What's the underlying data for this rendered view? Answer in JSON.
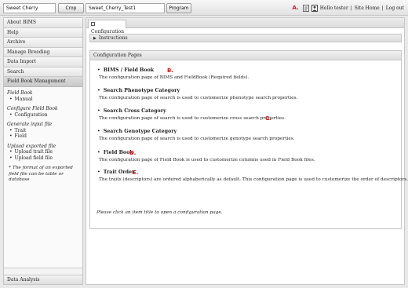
{
  "topbar": {
    "crop_value": "Sweet Cherry",
    "crop_button": "Crop",
    "program_value": "Sweet_Cherry_Test1",
    "program_button": "Program",
    "marker": "A.",
    "greeting": "Hello tester",
    "sep1": "|",
    "site_home": "Site Home",
    "sep2": "|",
    "logout": "Log out"
  },
  "sidebar": {
    "items": [
      {
        "label": "About BIMS"
      },
      {
        "label": "Help"
      },
      {
        "label": "Archive"
      },
      {
        "label": "Manage Breeding"
      },
      {
        "label": "Data Import"
      },
      {
        "label": "Search"
      },
      {
        "label": "Field Book Management"
      }
    ],
    "sub": {
      "field_book_head": "Field Book",
      "manual": "Manual",
      "configure_head": "Configure Field Book",
      "configuration": "Configuration",
      "generate_head": "Generate input file",
      "trait": "Trait",
      "field": "Field",
      "upload_head": "Upload exported file",
      "upload_trait": "Upload trait file",
      "upload_field": "Upload field file",
      "note": "* The format of an exported field file can be table or database"
    },
    "bottom": "Data Analysis"
  },
  "main": {
    "tab": "Configuration",
    "instructions": "Instructions",
    "panel_title": "Configuration Pages",
    "entries": [
      {
        "title": "BIMS / Field Book",
        "mark": "B.",
        "desc": "The configuration page of BIMS and FieldBook (Required fields)."
      },
      {
        "title": "Search Phenotype Category",
        "mark": "",
        "desc": "The configuration page of search is used to customerize phenotype search properties."
      },
      {
        "title": "Search Cross Category",
        "mark": "C.",
        "desc": "The configuration page of search is used to customerize cross search properties."
      },
      {
        "title": "Search Genotype Category",
        "mark": "",
        "desc": "The configuration page of search is used to customerize genotype search properties."
      },
      {
        "title": "Field Book",
        "mark": "D.",
        "desc": "The configuration page of Field Book is used to customerize columns used in Field Book files."
      },
      {
        "title": "Trait Order",
        "mark": "E.",
        "desc": "The traits (descriptors) are ordered alphaberically as default. This configuration page is used to customerize the order of descriptors."
      }
    ],
    "footnote": "Please click an item title to open a configuration page."
  },
  "colors": {
    "marker_red": "#d11111",
    "page_bg": "#e9e9e9"
  },
  "icons": [
    "settings-icon",
    "user-icon",
    "tab-icon",
    "expand-triangle-icon"
  ]
}
